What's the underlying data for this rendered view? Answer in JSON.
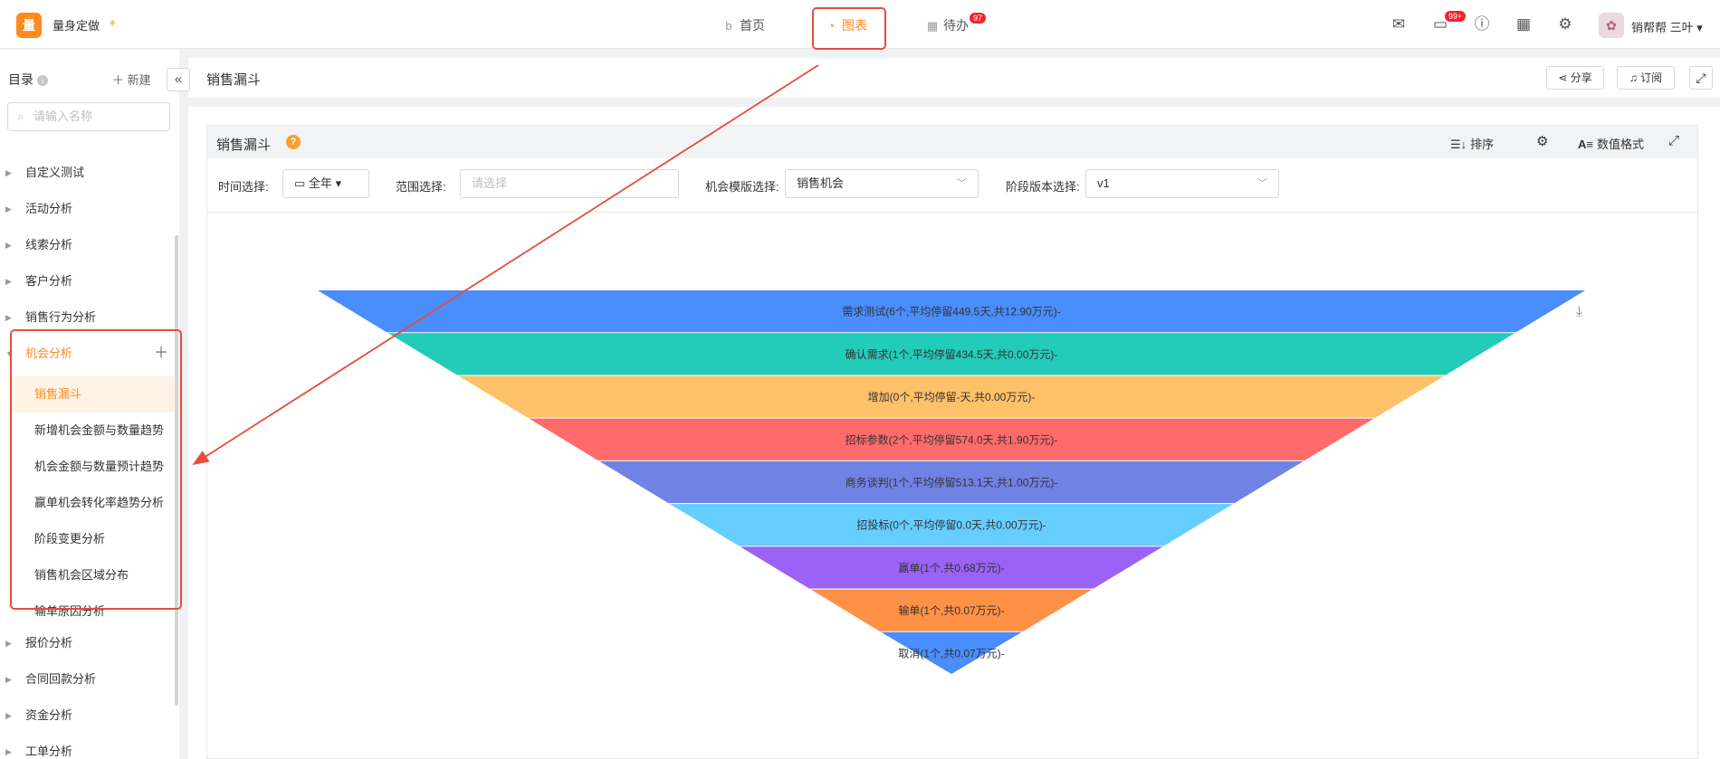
{
  "header": {
    "logo_text": "量",
    "app_name": "量身定做",
    "nav": [
      {
        "label": "首页"
      },
      {
        "label": "图表"
      },
      {
        "label": "待办",
        "badge": "97"
      }
    ],
    "message_badge": "99+",
    "user_name": "销帮帮 三叶"
  },
  "sidebar": {
    "title": "目录",
    "info_icon": "i",
    "new_label": "新建",
    "search_placeholder": "请输入名称",
    "groups_top": [
      "自定义测试",
      "活动分析",
      "线索分析",
      "客户分析",
      "销售行为分析"
    ],
    "active_group": "机会分析",
    "sub_items": [
      "销售漏斗",
      "新增机会金额与数量趋势",
      "机会金额与数量预计趋势",
      "赢单机会转化率趋势分析",
      "阶段变更分析",
      "销售机会区域分布",
      "输单原因分析"
    ],
    "groups_bottom": [
      "报价分析",
      "合同回款分析",
      "资金分析",
      "工单分析"
    ]
  },
  "main": {
    "title": "销售漏斗",
    "share_label": "分享",
    "subscribe_label": "订阅"
  },
  "card": {
    "title": "销售漏斗",
    "help_icon": "?",
    "sort_label": "排序",
    "format_label": "数值格式",
    "filters": {
      "time_label": "时间选择:",
      "time_value": "全年",
      "range_label": "范围选择:",
      "range_placeholder": "请选择",
      "template_label": "机会模版选择:",
      "template_value": "销售机会",
      "stage_label": "阶段版本选择:",
      "stage_value": "v1"
    }
  },
  "chart_data": {
    "type": "funnel",
    "stages": [
      {
        "label": "需求测试(6个,平均停留449.5天,共12.90万元)-",
        "color": "#4a8dfc"
      },
      {
        "label": "确认需求(1个,平均停留434.5天,共0.00万元)-",
        "color": "#23cbb9"
      },
      {
        "label": "增加(0个,平均停留-天,共0.00万元)-",
        "color": "#ffc06a"
      },
      {
        "label": "招标参数(2个,平均停留574.0天,共1.90万元)-",
        "color": "#ff6b6b"
      },
      {
        "label": "商务谈判(1个,平均停留513.1天,共1.00万元)-",
        "color": "#7182e5"
      },
      {
        "label": "招投标(0个,平均停留0.0天,共0.00万元)-",
        "color": "#66ceff"
      },
      {
        "label": "赢单(1个,共0.68万元)-",
        "color": "#9a62f5"
      },
      {
        "label": "输单(1个,共0.07万元)-",
        "color": "#ff9146"
      },
      {
        "label": "取消(1个,共0.07万元)-",
        "color": "#4a8dfc"
      }
    ]
  },
  "colors": {
    "accent": "#ff8a1f",
    "highlight": "#e74c3c"
  }
}
